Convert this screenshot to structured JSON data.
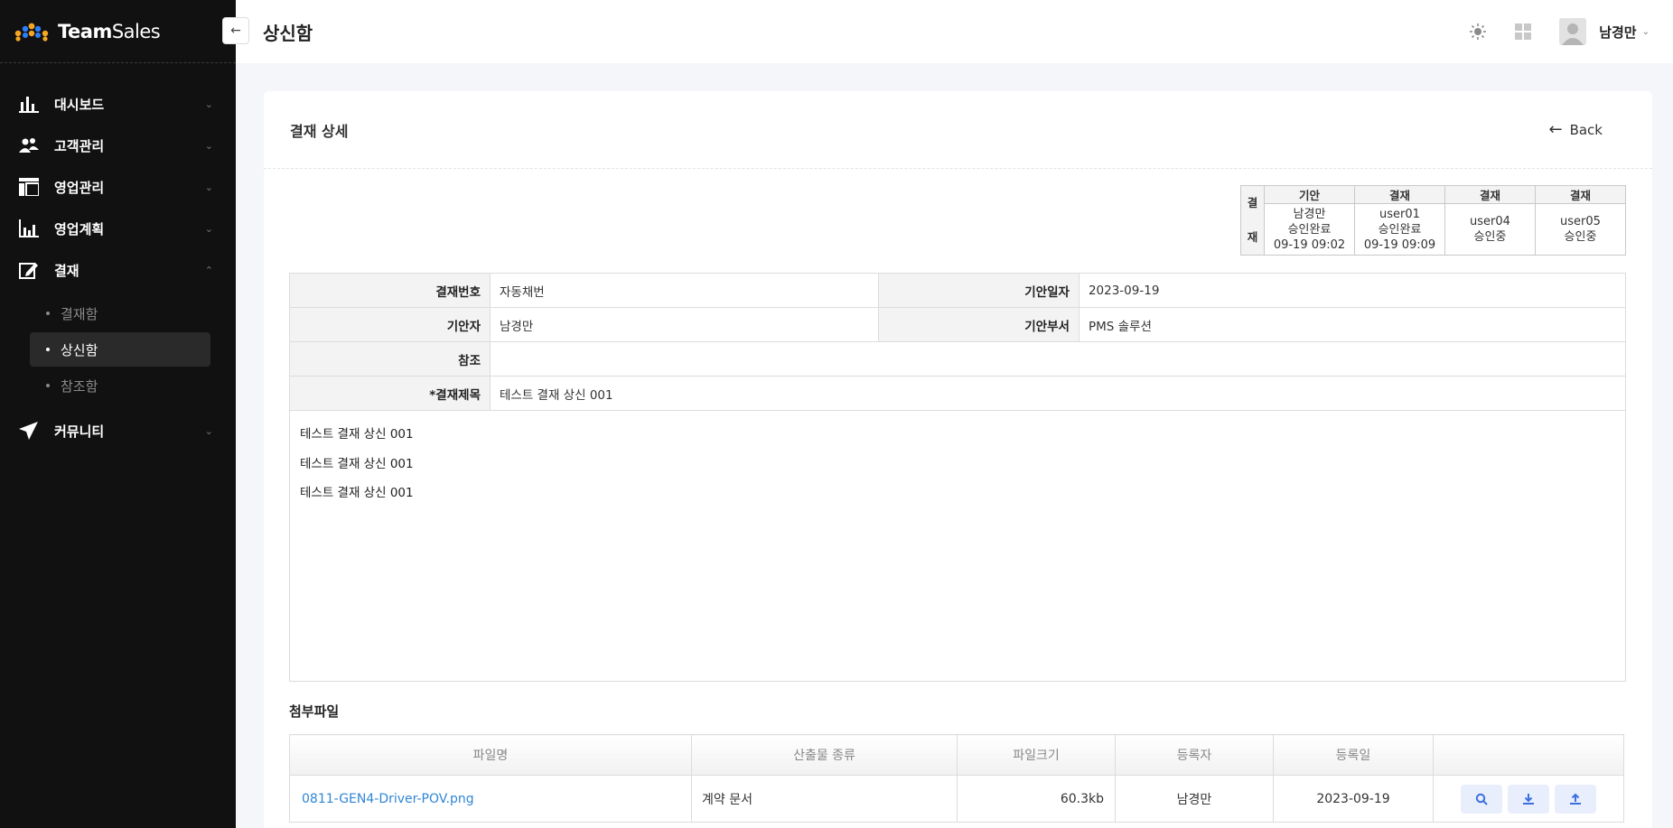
{
  "brand": {
    "name_bold": "Team",
    "name_light": "Sales",
    "dot_colors": [
      "#f5a623",
      "#2d7ff9",
      "#f5a623",
      "#2d7ff9",
      "#f5a623"
    ]
  },
  "sidebar": {
    "items": [
      {
        "label": "대시보드",
        "icon": "bar-chart-icon"
      },
      {
        "label": "고객관리",
        "icon": "users-icon"
      },
      {
        "label": "영업관리",
        "icon": "layout-icon"
      },
      {
        "label": "영업계획",
        "icon": "line-chart-icon"
      },
      {
        "label": "결재",
        "icon": "edit-icon",
        "expanded": true,
        "children": [
          {
            "label": "결재함"
          },
          {
            "label": "상신함",
            "active": true
          },
          {
            "label": "참조함"
          }
        ]
      },
      {
        "label": "커뮤니티",
        "icon": "send-icon"
      }
    ]
  },
  "header": {
    "title": "상신함",
    "collapse_symbol": "←",
    "user_name": "남경만"
  },
  "card": {
    "title": "결재 상세",
    "back_label": "Back"
  },
  "approval_line": {
    "side_label_1": "결",
    "side_label_2": "재",
    "columns": [
      {
        "header": "기안",
        "user": "남경만",
        "status": "승인완료",
        "time": "09-19 09:02"
      },
      {
        "header": "결재",
        "user": "user01",
        "status": "승인완료",
        "time": "09-19 09:09"
      },
      {
        "header": "결재",
        "user": "user04",
        "status": "승인중",
        "time": ""
      },
      {
        "header": "결재",
        "user": "user05",
        "status": "승인중",
        "time": ""
      }
    ]
  },
  "info": {
    "doc_no_label": "결재번호",
    "doc_no_value": "자동채번",
    "draft_date_label": "기안일자",
    "draft_date_value": "2023-09-19",
    "drafter_label": "기안자",
    "drafter_value": "남경만",
    "dept_label": "기안부서",
    "dept_value": "PMS 솔루션",
    "ref_label": "참조",
    "ref_value": "",
    "subject_label": "*결재제목",
    "subject_value": "테스트 결재 상신 001"
  },
  "body_lines": [
    "테스트 결재 상신 001",
    "테스트 결재 상신 001",
    "테스트 결재 상신 001"
  ],
  "attachments": {
    "title": "첨부파일",
    "headers": [
      "파일명",
      "산출물 종류",
      "파일크기",
      "등록자",
      "등록일",
      ""
    ],
    "rows": [
      {
        "file": "0811-GEN4-Driver-POV.png",
        "type": "계약 문서",
        "size": "60.3kb",
        "owner": "남경만",
        "date": "2023-09-19"
      }
    ]
  }
}
